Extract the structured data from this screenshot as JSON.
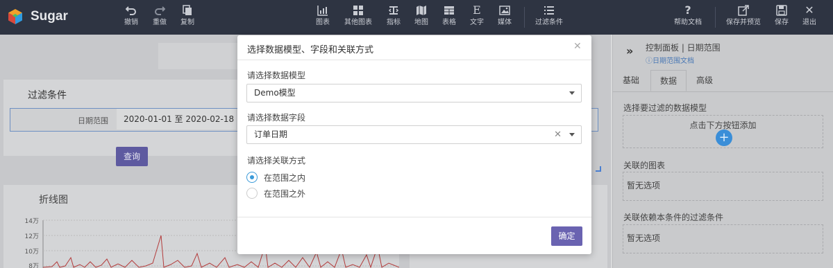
{
  "app": {
    "brand": "Sugar"
  },
  "toolbar": {
    "left": [
      {
        "label": "撤销",
        "icon": "undo-icon"
      },
      {
        "label": "重做",
        "icon": "redo-icon"
      },
      {
        "label": "复制",
        "icon": "copy-icon"
      }
    ],
    "center": [
      {
        "label": "图表",
        "icon": "chart-icon"
      },
      {
        "label": "其他图表",
        "icon": "grid-icon"
      },
      {
        "label": "指标",
        "icon": "metric-icon"
      },
      {
        "label": "地图",
        "icon": "map-icon"
      },
      {
        "label": "表格",
        "icon": "table-icon"
      },
      {
        "label": "文字",
        "icon": "text-icon"
      },
      {
        "label": "媒体",
        "icon": "image-icon"
      },
      {
        "label": "过滤条件",
        "icon": "list-icon"
      }
    ],
    "right": [
      {
        "label": "帮助文档",
        "icon": "help-icon"
      },
      {
        "label": "保存并预览",
        "icon": "preview-icon"
      },
      {
        "label": "保存",
        "icon": "save-icon"
      },
      {
        "label": "退出",
        "icon": "exit-icon"
      }
    ]
  },
  "canvas": {
    "filter_title": "过滤条件",
    "date_label": "日期范围",
    "date_value": "2020-01-01 至 2020-02-18",
    "query_button": "查询",
    "chart_title": "折线图",
    "y_ticks": [
      "14万",
      "12万",
      "10万",
      "8万"
    ]
  },
  "right_panel": {
    "title": "控制面板 | 日期范围",
    "doc_link": "日期范围文档",
    "tabs": [
      "基础",
      "数据",
      "高级"
    ],
    "active_tab": "数据",
    "section1_label": "选择要过滤的数据模型",
    "section1_hint": "点击下方按钮添加",
    "section2_label": "关联的图表",
    "section2_value": "暂无选项",
    "section3_label": "关联依赖本条件的过滤条件",
    "section3_value": "暂无选项"
  },
  "modal": {
    "title": "选择数据模型、字段和关联方式",
    "model_label": "请选择数据模型",
    "model_value": "Demo模型",
    "field_label": "请选择数据字段",
    "field_value": "订单日期",
    "relation_label": "请选择关联方式",
    "options": [
      "在范围之内",
      "在范围之外"
    ],
    "selected_option": "在范围之内",
    "confirm": "确定"
  },
  "colors": {
    "topbar": "#2e3442",
    "accent": "#6a63b1",
    "radio": "#3a9ad9",
    "link": "#4a78b5"
  }
}
